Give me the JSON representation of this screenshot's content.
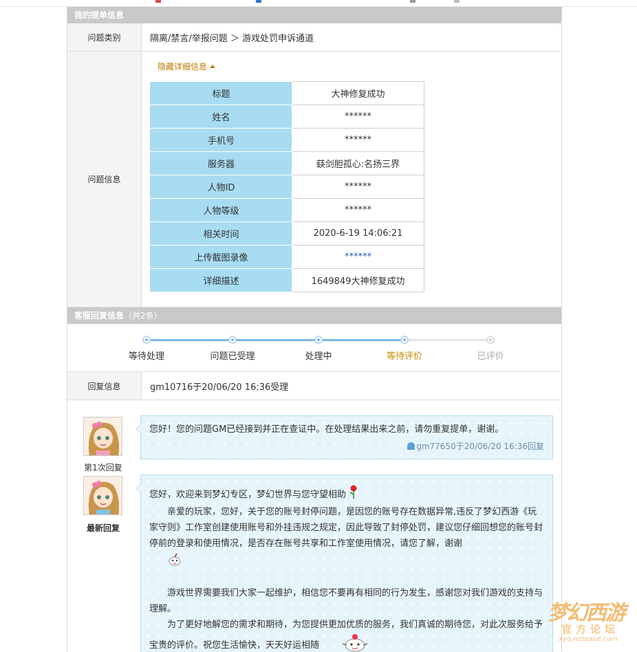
{
  "section_form": {
    "title": "我的提单信息"
  },
  "category": {
    "label": "问题类别",
    "value": "隔离/禁言/举报问题 ＞ 游戏处罚申诉通道"
  },
  "problem": {
    "label": "问题信息",
    "toggle_label": "隐藏详细信息",
    "fields": [
      {
        "key": "标题",
        "value": "大神修复成功"
      },
      {
        "key": "姓名",
        "value": "******"
      },
      {
        "key": "手机号",
        "value": "******"
      },
      {
        "key": "服务器",
        "value": "蒛剑胆孤心:名扬三界"
      },
      {
        "key": "人物ID",
        "value": "******"
      },
      {
        "key": "人物等级",
        "value": "******"
      },
      {
        "key": "相关时间",
        "value": "2020-6-19 14:06:21"
      },
      {
        "key": "上传截图录像",
        "value": "******"
      },
      {
        "key": "详细描述",
        "value": "1649849大神修复成功"
      }
    ]
  },
  "section_reply": {
    "title": "客服回复信息",
    "count": "（共2条）"
  },
  "progress": {
    "steps": [
      {
        "label": "等待处理",
        "state": "done"
      },
      {
        "label": "问题已受理",
        "state": "done"
      },
      {
        "label": "处理中",
        "state": "done"
      },
      {
        "label": "等待评价",
        "state": "current"
      },
      {
        "label": "已评价",
        "state": "off"
      }
    ]
  },
  "reply_info": {
    "label": "回复信息",
    "value": "gm10716于20/06/20 16:36受理"
  },
  "replies": [
    {
      "avatar_label": "第1次回复",
      "text": "您好！您的问题GM已经接到并正在查证中。在处理结果出来之前，请勿重复提单，谢谢。",
      "signature": "gm77650于20/06/20 16:36回复"
    },
    {
      "avatar_label": "最新回复",
      "greeting": "您好，欢迎来到梦幻专区，梦幻世界与您守望相助",
      "para1": "亲爱的玩家，您好，关于您的账号封停问题，是因您的账号存在数据异常,违反了梦幻西游《玩家守则》工作室创建使用账号和外挂违规之规定，因此导致了封停处罚，建议您仔细回想您的账号封停前的登录和使用情况，是否存在账号共享和工作室使用情况，请您了解，谢谢",
      "para2": "游戏世界需要我们大家一起维护，相信您不要再有相同的行为发生，感谢您对我们游戏的支持与理解。",
      "para3": "为了更好地解您的需求和期待，为您提供更加优质的服务，我们真诚的期待您，对此次服务给予宝贵的评价。祝您生活愉快，天天好运相随"
    }
  ],
  "watermark": {
    "line1": "梦幻西游",
    "line2": "官方论坛",
    "line3": "xyq.netease.com"
  },
  "colors": {
    "header_bg": "#c9c9c9",
    "key_cell": "#a8dcf2",
    "bubble_bg": "#e6f5fb",
    "accent_orange": "#c98a00"
  }
}
